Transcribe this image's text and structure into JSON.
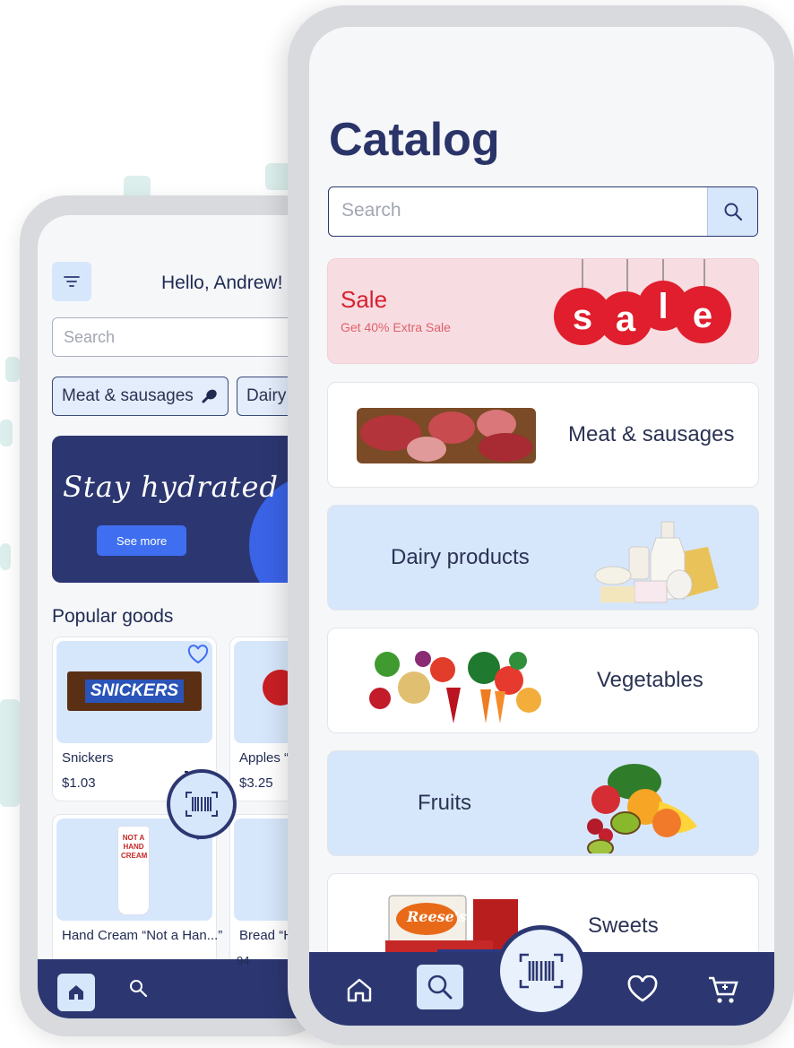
{
  "back_phone": {
    "greeting": "Hello, Andrew!",
    "search_placeholder": "Search",
    "chips": [
      "Meat & sausages",
      "Dairy"
    ],
    "banner": {
      "title": "Stay hydrated",
      "button": "See more"
    },
    "section_title": "Popular goods",
    "products": [
      {
        "name": "Snickers",
        "price": "$1.03",
        "favorite": false,
        "logo": "SNICKERS"
      },
      {
        "name": "Apples “F",
        "price": "$3.25",
        "favorite": false
      },
      {
        "name": "Hand Cream “Not a Han...”",
        "price": "",
        "favorite": true,
        "logo": "NOT A HAND CREAM"
      },
      {
        "name": "Bread “H",
        "price": "94",
        "favorite": false
      }
    ],
    "nav": [
      "home-icon",
      "search-icon",
      "barcode-icon"
    ]
  },
  "front_phone": {
    "title": "Catalog",
    "search_placeholder": "Search",
    "sale": {
      "title": "Sale",
      "subtitle": "Get 40% Extra Sale",
      "tags": [
        "s",
        "a",
        "l",
        "e"
      ]
    },
    "categories": [
      {
        "label": "Meat & sausages",
        "image": "meat"
      },
      {
        "label": "Dairy products",
        "image": "dairy"
      },
      {
        "label": "Vegetables",
        "image": "vegetables"
      },
      {
        "label": "Fruits",
        "image": "fruits"
      },
      {
        "label": "Sweets",
        "image": "sweets"
      }
    ],
    "sweets_box_label": "Reese's",
    "nav": [
      "home-icon",
      "search-icon",
      "barcode-icon",
      "heart-icon",
      "cart-icon"
    ]
  },
  "colors": {
    "navy": "#2c3772",
    "light_blue": "#d7e7fb",
    "sale_red": "#d9202f",
    "sale_bg": "#f7dde2"
  }
}
